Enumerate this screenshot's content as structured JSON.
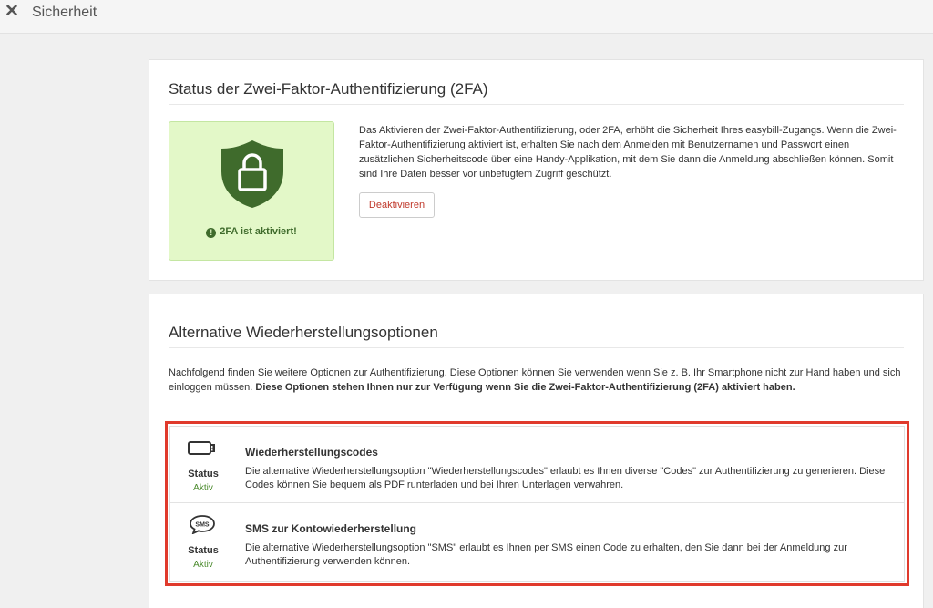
{
  "topbar": {
    "close_icon": "close-icon",
    "title": "Sicherheit"
  },
  "twofa": {
    "title": "Status der Zwei-Faktor-Authentifizierung (2FA)",
    "shield_icon": "shield-lock-icon",
    "status_message": "2FA ist aktiviert!",
    "description": "Das Aktivieren der Zwei-Faktor-Authentifizierung, oder 2FA, erhöht die Sicherheit Ihres easybill-Zugangs. Wenn die Zwei-Faktor-Authentifizierung aktiviert ist, erhalten Sie nach dem Anmelden mit Benutzernamen und Passwort einen zusätzlichen Sicherheitscode über eine Handy-Applikation, mit dem Sie dann die Anmeldung abschließen können. Somit sind Ihre Daten besser vor unbefugtem Zugriff geschützt.",
    "deactivate_label": "Deaktivieren",
    "colors": {
      "box_bg": "#e3f8c8",
      "shield": "#3f6b2c",
      "deactivate_text": "#c0392b"
    }
  },
  "alternatives": {
    "title": "Alternative Wiederherstellungsoptionen",
    "intro_plain": "Nachfolgend finden Sie weitere Optionen zur Authentifizierung. Diese Optionen können Sie verwenden wenn Sie z. B. Ihr Smartphone nicht zur Hand haben und sich einloggen müssen. ",
    "intro_bold": "Diese Optionen stehen Ihnen nur zur Verfügung wenn Sie die Zwei-Faktor-Authentifizierung (2FA) aktiviert haben.",
    "highlight_color": "#e03a2c",
    "options": [
      {
        "icon": "usb-drive-icon",
        "status_label": "Status",
        "status_value": "Aktiv",
        "title": "Wiederherstellungscodes",
        "description": "Die alternative Wiederherstellungsoption \"Wiederherstellungscodes\" erlaubt es Ihnen diverse \"Codes\" zur Authentifizierung zu generieren. Diese Codes können Sie bequem als PDF runterladen und bei Ihren Unterlagen verwahren."
      },
      {
        "icon": "sms-bubble-icon",
        "status_label": "Status",
        "status_value": "Aktiv",
        "title": "SMS zur Kontowiederherstellung",
        "description": "Die alternative Wiederherstellungsoption \"SMS\" erlaubt es Ihnen per SMS einen Code zu erhalten, den Sie dann bei der Anmeldung zur Authentifizierung verwenden können."
      }
    ]
  }
}
